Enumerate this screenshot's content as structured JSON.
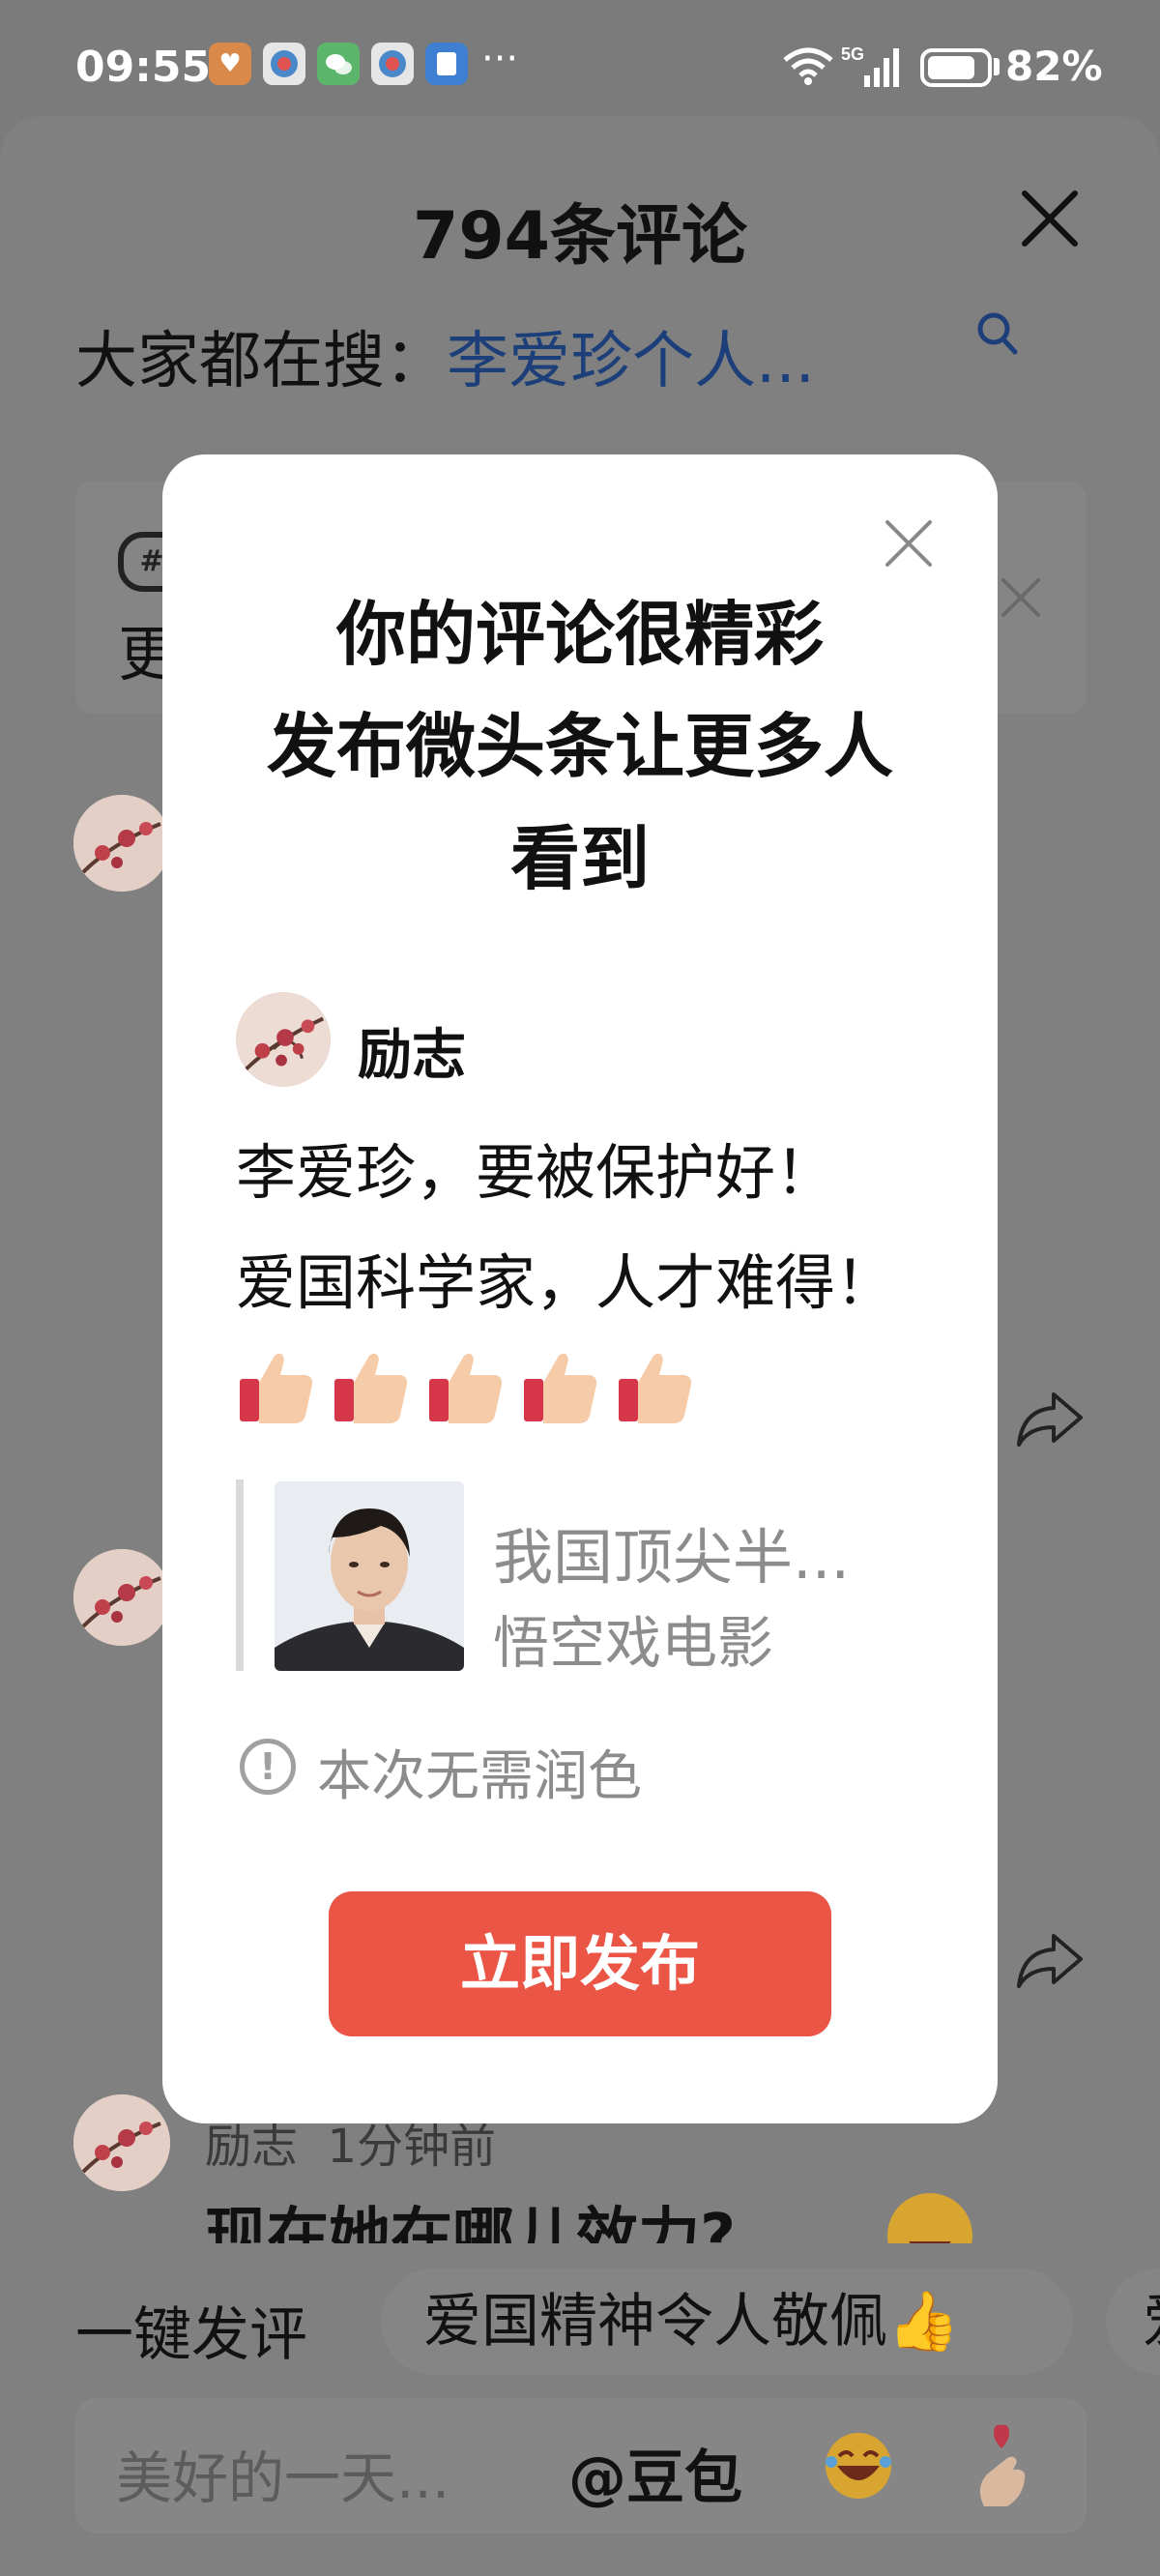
{
  "status_bar": {
    "time": "09:55",
    "network": "5G",
    "battery_text": "82%",
    "battery_level": 0.82
  },
  "sheet": {
    "title": "794条评论",
    "search_prefix": "大家都在搜：",
    "search_term": "李爱珍个人...",
    "topic_card": {
      "icon_text": "#",
      "text": "更"
    },
    "background_comment": {
      "author": "励志",
      "time": "1分钟前",
      "text": "现在她在哪儿效力?"
    },
    "quick_reply": {
      "label": "一键发评",
      "chip_1": "爱国精神令人敬佩👍",
      "chip_2": "爱"
    },
    "input": {
      "placeholder": "美好的一天...",
      "mention": "@豆包"
    }
  },
  "modal": {
    "title_lines": [
      "你的评论很精彩",
      "发布微头条让更多人",
      "看到"
    ],
    "username": "励志",
    "comment_lines": [
      "李爱珍，要被保护好！",
      "爱国科学家，人才难得！"
    ],
    "thumbs_count": 5,
    "quote": {
      "title": "我国顶尖半...",
      "source": "悟空戏电影"
    },
    "notice": "本次无需润色",
    "publish_button": "立即发布"
  },
  "colors": {
    "accent": "#ea5546",
    "search_term": "#1c3f79",
    "overlay": "#7b7b7b"
  }
}
